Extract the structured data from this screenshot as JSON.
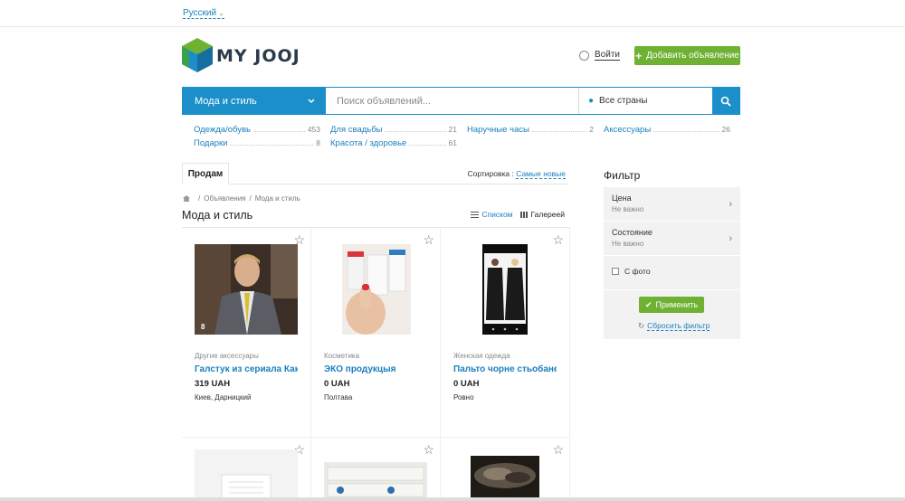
{
  "top": {
    "language": "Русский"
  },
  "header": {
    "logo_text": "MY JOOJ",
    "login": "Войти",
    "add_listing": "Добавить объявление"
  },
  "search": {
    "category": "Мода и стиль",
    "placeholder": "Поиск объявлений...",
    "region": "Все страны"
  },
  "subcategories": [
    {
      "name": "Одежда/обувь",
      "count": "453"
    },
    {
      "name": "Для свадьбы",
      "count": "21"
    },
    {
      "name": "Наручные часы",
      "count": "2"
    },
    {
      "name": "Аксессуары",
      "count": "26"
    },
    {
      "name": "Подарки",
      "count": "8"
    },
    {
      "name": "Красота / здоровье",
      "count": "61"
    }
  ],
  "tabs": {
    "active": "Продам"
  },
  "sort": {
    "label": "Сортировка :",
    "value": "Самые новые"
  },
  "breadcrumbs": [
    "Объявления",
    "Мода и стиль"
  ],
  "page_title": "Мода и стиль",
  "view": {
    "list": "Списком",
    "gallery": "Галереей"
  },
  "listings": [
    {
      "category": "Другие аксессуары",
      "title": "Галстук из сериала Как",
      "price": "319 UAH",
      "location": "Киев, Дарницкий",
      "photos": "8"
    },
    {
      "category": "Косметика",
      "title": "ЭКО продукцыя",
      "price": "0 UAH",
      "location": "Полтава",
      "photos": ""
    },
    {
      "category": "Женская одежда",
      "title": "Пальто чорне стьобане",
      "price": "0 UAH",
      "location": "Ровно",
      "photos": ""
    }
  ],
  "filter": {
    "title": "Фильтр",
    "price_label": "Цена",
    "price_value": "Не важно",
    "condition_label": "Состояние",
    "condition_value": "Не важно",
    "photo_only": "С фото",
    "apply": "Применить",
    "reset": "Сбросить фильтр"
  },
  "colors": {
    "accent_blue": "#1a8fc9",
    "accent_green": "#6fb233"
  }
}
